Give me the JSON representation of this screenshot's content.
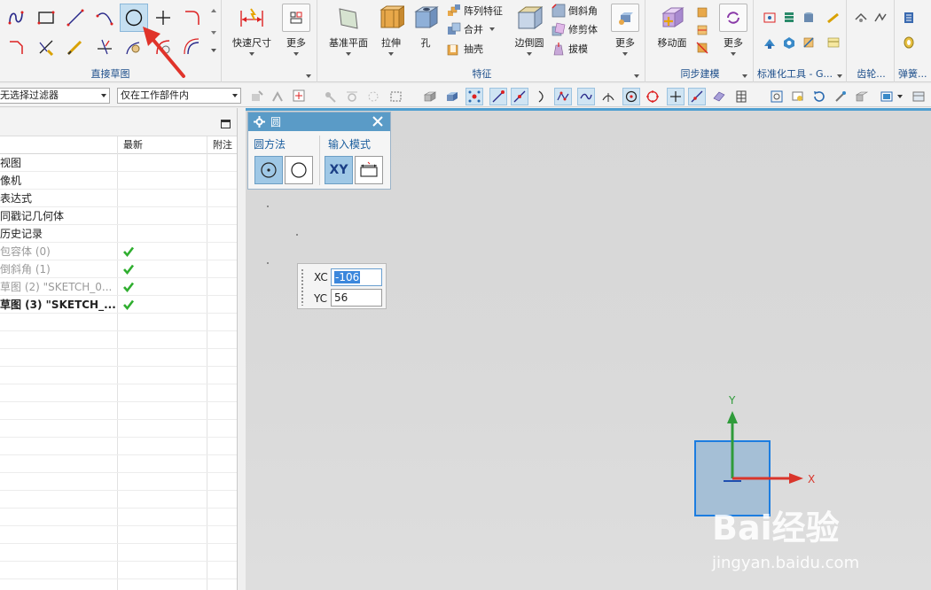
{
  "ribbon": {
    "groups": {
      "direct_sketch": "直接草图",
      "features": "特征",
      "sync_modeling": "同步建模",
      "std_tools": "标准化工具 - G...",
      "gear": "齿轮...",
      "spring": "弹簧..."
    },
    "buttons": {
      "rapid_dimension": "快速尺寸",
      "more": "更多",
      "datum_plane": "基准平面",
      "extrude": "拉伸",
      "hole": "孔",
      "pattern_feature": "阵列特征",
      "unite": "合并",
      "shell": "抽壳",
      "edge_blend": "边倒圆",
      "chamfer": "倒斜角",
      "trim_body": "修剪体",
      "draft": "拔模",
      "move_face": "移动面"
    }
  },
  "selbar": {
    "filter": "无选择过滤器",
    "scope": "仅在工作部件内"
  },
  "navigator": {
    "columns": [
      "最新",
      "附注"
    ],
    "rows": [
      {
        "label": "视图",
        "check": false,
        "style": "normal"
      },
      {
        "label": "像机",
        "check": false,
        "style": "normal"
      },
      {
        "label": "表达式",
        "check": false,
        "style": "normal"
      },
      {
        "label": "同戳记几何体",
        "check": false,
        "style": "normal"
      },
      {
        "label": "历史记录",
        "check": false,
        "style": "normal"
      },
      {
        "label": "包容体 (0)",
        "check": true,
        "style": "dim"
      },
      {
        "label": "倒斜角 (1)",
        "check": true,
        "style": "dim"
      },
      {
        "label": "草图 (2) \"SKETCH_0...",
        "check": true,
        "style": "dim"
      },
      {
        "label": "草图 (3) \"SKETCH_...",
        "check": true,
        "style": "bold"
      }
    ]
  },
  "dialog": {
    "title": "圆",
    "method_title": "圆方法",
    "input_title": "输入模式",
    "xy_label": "XY"
  },
  "coord": {
    "xc_label": "XC",
    "xc_value": "-106",
    "yc_label": "YC",
    "yc_value": "56"
  },
  "triad": {
    "x_label": "X",
    "y_label": "Y"
  },
  "watermark": {
    "brand": "Bai经验",
    "url": "jingyan.baidu.com"
  },
  "colors": {
    "accent": "#5a9bc7",
    "axis_x": "#d9352b",
    "axis_y": "#2f9b3a",
    "axis_z": "#1f4fb0",
    "check": "#2fae2f"
  }
}
